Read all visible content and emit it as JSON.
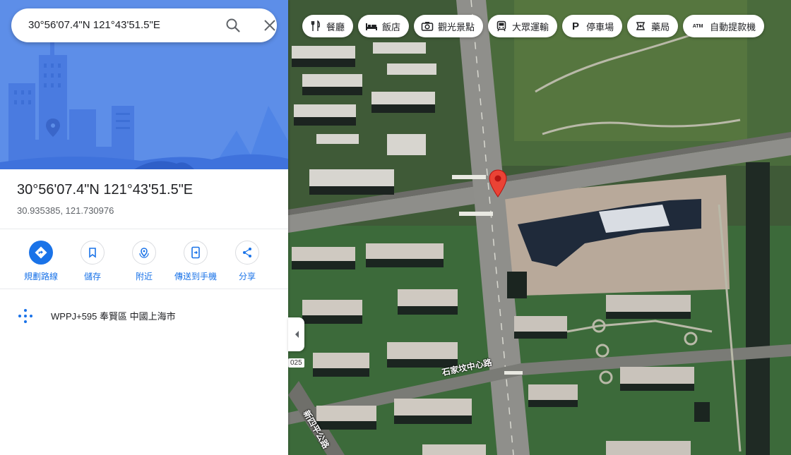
{
  "search": {
    "query": "30°56'07.4\"N 121°43'51.5\"E"
  },
  "place": {
    "title": "30°56'07.4\"N 121°43'51.5\"E",
    "decimal_coords": "30.935385, 121.730976"
  },
  "actions": [
    {
      "label": "規劃路線",
      "icon": "directions-icon"
    },
    {
      "label": "儲存",
      "icon": "bookmark-icon"
    },
    {
      "label": "附近",
      "icon": "nearby-icon"
    },
    {
      "label": "傳送到手機",
      "icon": "send-to-phone-icon"
    },
    {
      "label": "分享",
      "icon": "share-icon"
    }
  ],
  "plus_code": "WPPJ+595 奉賢區 中國上海市",
  "chips": [
    {
      "label": "餐廳",
      "icon": "fork-knife-icon"
    },
    {
      "label": "飯店",
      "icon": "bed-icon"
    },
    {
      "label": "觀光景點",
      "icon": "camera-icon"
    },
    {
      "label": "大眾運輸",
      "icon": "transit-icon"
    },
    {
      "label": "停車場",
      "icon": "parking-icon",
      "glyph": "P"
    },
    {
      "label": "藥局",
      "icon": "pharmacy-icon"
    },
    {
      "label": "自動提款機",
      "icon": "atm-icon",
      "glyph": "ATM"
    }
  ],
  "map": {
    "road_label": "石家坟中心路",
    "road_label_2": "新四平公路",
    "route_shield": "025",
    "pin_color": "#ea4335"
  },
  "colors": {
    "accent": "#1a73e8",
    "hero_bg": "#5d8ee8"
  }
}
